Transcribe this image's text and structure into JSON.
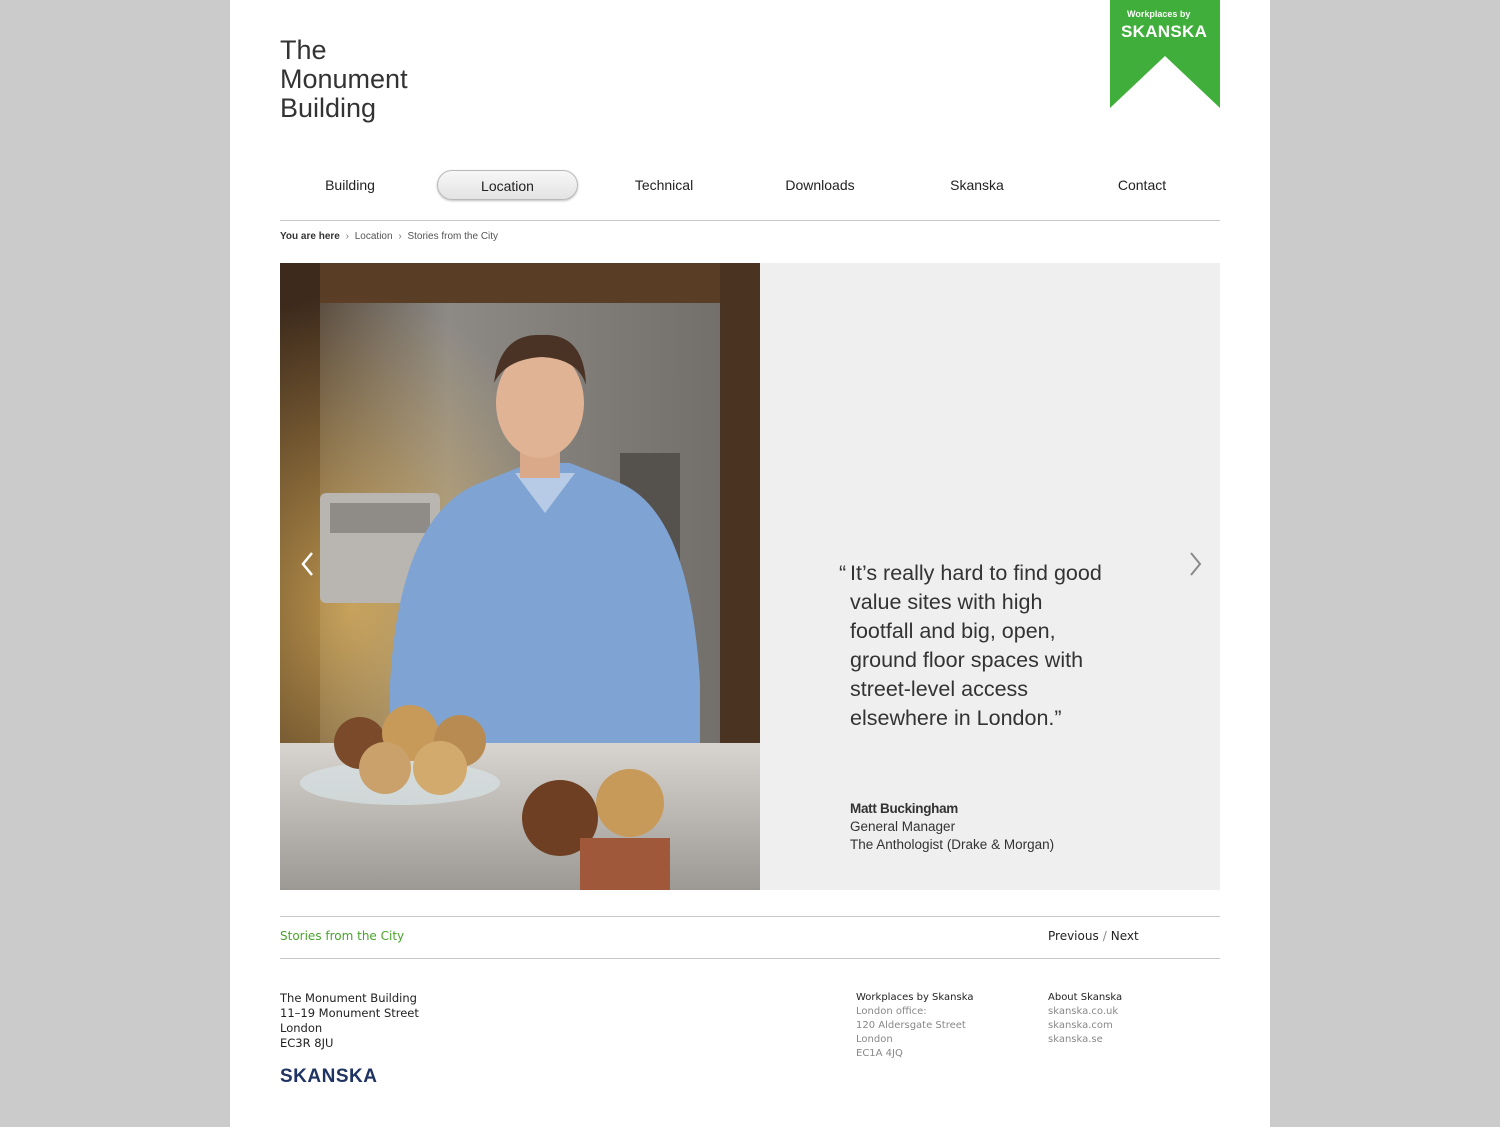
{
  "site": {
    "title_lines": [
      "The",
      "Monument",
      "Building"
    ],
    "ribbon_top": "Workplaces by",
    "ribbon_brand": "SKANSKA",
    "brand_green": "#3fae3a"
  },
  "nav": {
    "items": [
      {
        "label": "Building"
      },
      {
        "label": "Location"
      },
      {
        "label": "Technical"
      },
      {
        "label": "Downloads"
      },
      {
        "label": "Skanska"
      },
      {
        "label": "Contact"
      }
    ],
    "active": "Location"
  },
  "breadcrumb": {
    "here": "You are here",
    "sep": "›",
    "items": [
      "Location",
      "Stories from the City"
    ]
  },
  "hero": {
    "photo_icon": "portrait-photo",
    "quote_open": "“",
    "quote": "It’s really hard to find good value sites with high footfall and big, open, ground floor spaces with street-level access elsewhere in London.”",
    "author_name": "Matt Buckingham",
    "author_role": "General Manager",
    "author_org": "The Anthologist (Drake & Morgan)",
    "prev_icon": "chevron-left-icon",
    "next_icon": "chevron-right-icon"
  },
  "section": {
    "title": "Stories from the City",
    "previous": "Previous",
    "slash": "/",
    "next": "Next"
  },
  "footer": {
    "address": [
      "The Monument Building",
      "11–19 Monument Street",
      "London",
      "EC3R 8JU"
    ],
    "logo": "SKANSKA",
    "col1": {
      "heading": "Workplaces by Skanska",
      "lines": [
        "London office:",
        "120 Aldersgate Street",
        "London",
        "EC1A 4JQ"
      ]
    },
    "col2": {
      "heading": "About Skanska",
      "links": [
        "skanska.co.uk",
        "skanska.com",
        "skanska.se"
      ]
    }
  }
}
